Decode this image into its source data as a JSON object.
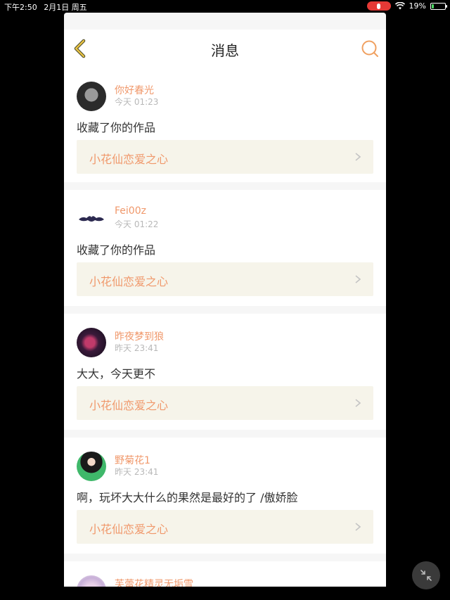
{
  "status_bar": {
    "time": "下午2:50",
    "date": "2月1日 周五",
    "battery": "19%",
    "battery_level": 0.19
  },
  "nav": {
    "title": "消息",
    "back_icon": "chevron-left-icon",
    "search_icon": "search-icon",
    "accent_color": "#e0a030"
  },
  "messages": [
    {
      "user": "你好春光",
      "time": "今天 01:23",
      "text": "收藏了你的作品",
      "work": "小花仙恋爱之心"
    },
    {
      "user": "Fei00z",
      "time": "今天 01:22",
      "text": "收藏了你的作品",
      "work": "小花仙恋爱之心"
    },
    {
      "user": "昨夜梦到狼",
      "time": "昨天 23:41",
      "text": "大大，今天更不",
      "work": "小花仙恋爱之心"
    },
    {
      "user": "野菊花1",
      "time": "昨天 23:41",
      "text": "啊，玩坏大大什么的果然是最好的了 /傲娇脸",
      "work": "小花仙恋爱之心"
    },
    {
      "user": "芙蕾花精灵无垢雪"
    }
  ],
  "colors": {
    "name": "#f0986b",
    "link_bg": "#f6f4ea",
    "page_bg": "#f6f6f6"
  },
  "floating_button_icon": "minimize-icon"
}
